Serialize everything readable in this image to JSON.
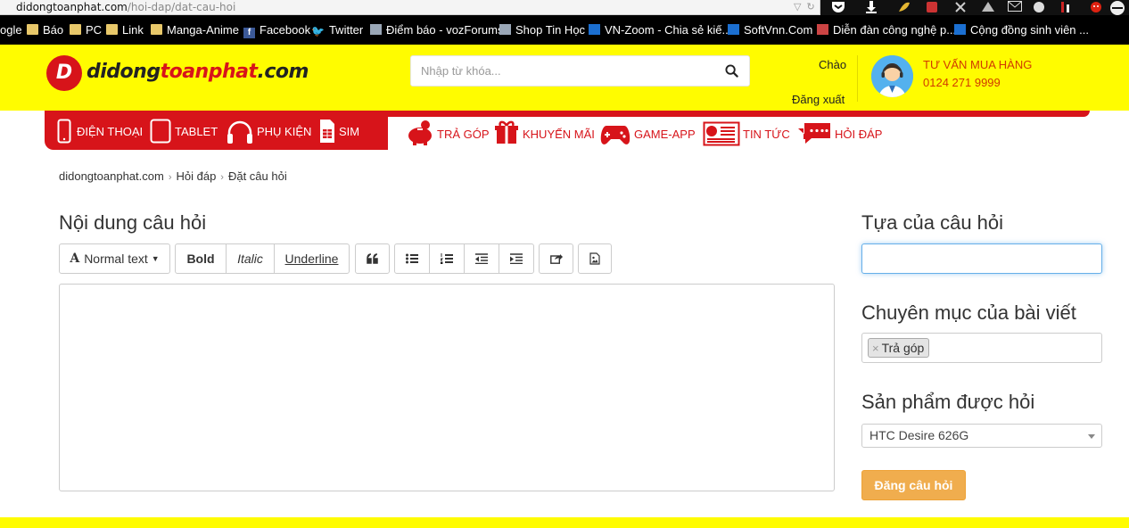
{
  "browser": {
    "url_host": "didongtoanphat.com",
    "url_path": "/hoi-dap/dat-cau-hoi",
    "bookmarks": [
      {
        "label": "ogle",
        "icon": "google-icon"
      },
      {
        "label": "Báo",
        "icon": "folder-icon"
      },
      {
        "label": "PC",
        "icon": "folder-icon"
      },
      {
        "label": "Link",
        "icon": "folder-icon"
      },
      {
        "label": "Manga-Anime",
        "icon": "folder-icon"
      },
      {
        "label": "Facebook",
        "icon": "facebook-icon"
      },
      {
        "label": "Twitter",
        "icon": "twitter-icon"
      },
      {
        "label": "Điểm báo - vozForums",
        "icon": "voz-icon"
      },
      {
        "label": "Shop Tin Học",
        "icon": "shop-icon"
      },
      {
        "label": "VN-Zoom - Chia sẻ kiế...",
        "icon": "vnzoom-icon"
      },
      {
        "label": "SoftVnn.Com",
        "icon": "softvnn-icon"
      },
      {
        "label": "Diễn đàn công nghệ p...",
        "icon": "forum-icon"
      },
      {
        "label": "Cộng đồng sinh viên ...",
        "icon": "community-icon"
      }
    ]
  },
  "header": {
    "logo_badge": "D",
    "logo_main": "didong",
    "logo_red": "toanphat",
    "logo_tld": ".com",
    "search_placeholder": "Nhập từ khóa...",
    "greeting": "Chào",
    "logout": "Đăng xuất",
    "advice_title": "TƯ VẤN MUA HÀNG",
    "advice_phone": "0124 271 9999"
  },
  "nav": {
    "main": [
      {
        "label": "ĐIỆN THOẠI",
        "icon": "phone-icon"
      },
      {
        "label": "TABLET",
        "icon": "tablet-icon"
      },
      {
        "label": "PHỤ KIỆN",
        "icon": "headphones-icon"
      },
      {
        "label": "SIM",
        "icon": "sim-icon"
      }
    ],
    "secondary": [
      {
        "label": "TRẢ GÓP",
        "icon": "piggy-bank-icon"
      },
      {
        "label": "KHUYẾN MÃI",
        "icon": "gift-icon"
      },
      {
        "label": "GAME-APP",
        "icon": "gamepad-icon"
      },
      {
        "label": "TIN TỨC",
        "icon": "news-icon"
      },
      {
        "label": "HỎI ĐÁP",
        "icon": "chat-icon"
      }
    ]
  },
  "breadcrumb": [
    "didongtoanphat.com",
    "Hỏi đáp",
    "Đặt câu hỏi"
  ],
  "editor": {
    "heading": "Nội dung câu hỏi",
    "format_label": "Normal text",
    "bold": "Bold",
    "italic": "Italic",
    "underline": "Underline"
  },
  "sidebar": {
    "title_heading": "Tựa của câu hỏi",
    "category_heading": "Chuyên mục của bài viết",
    "category_tag": "Trả góp",
    "product_heading": "Sản phẩm được hỏi",
    "product_value": "HTC Desire 626G",
    "submit_label": "Đăng câu hỏi"
  },
  "colors": {
    "header_bg": "#fffc00",
    "brand_red": "#d7141a",
    "submit_bg": "#f0ad4e",
    "advice_text": "#d13a00"
  }
}
